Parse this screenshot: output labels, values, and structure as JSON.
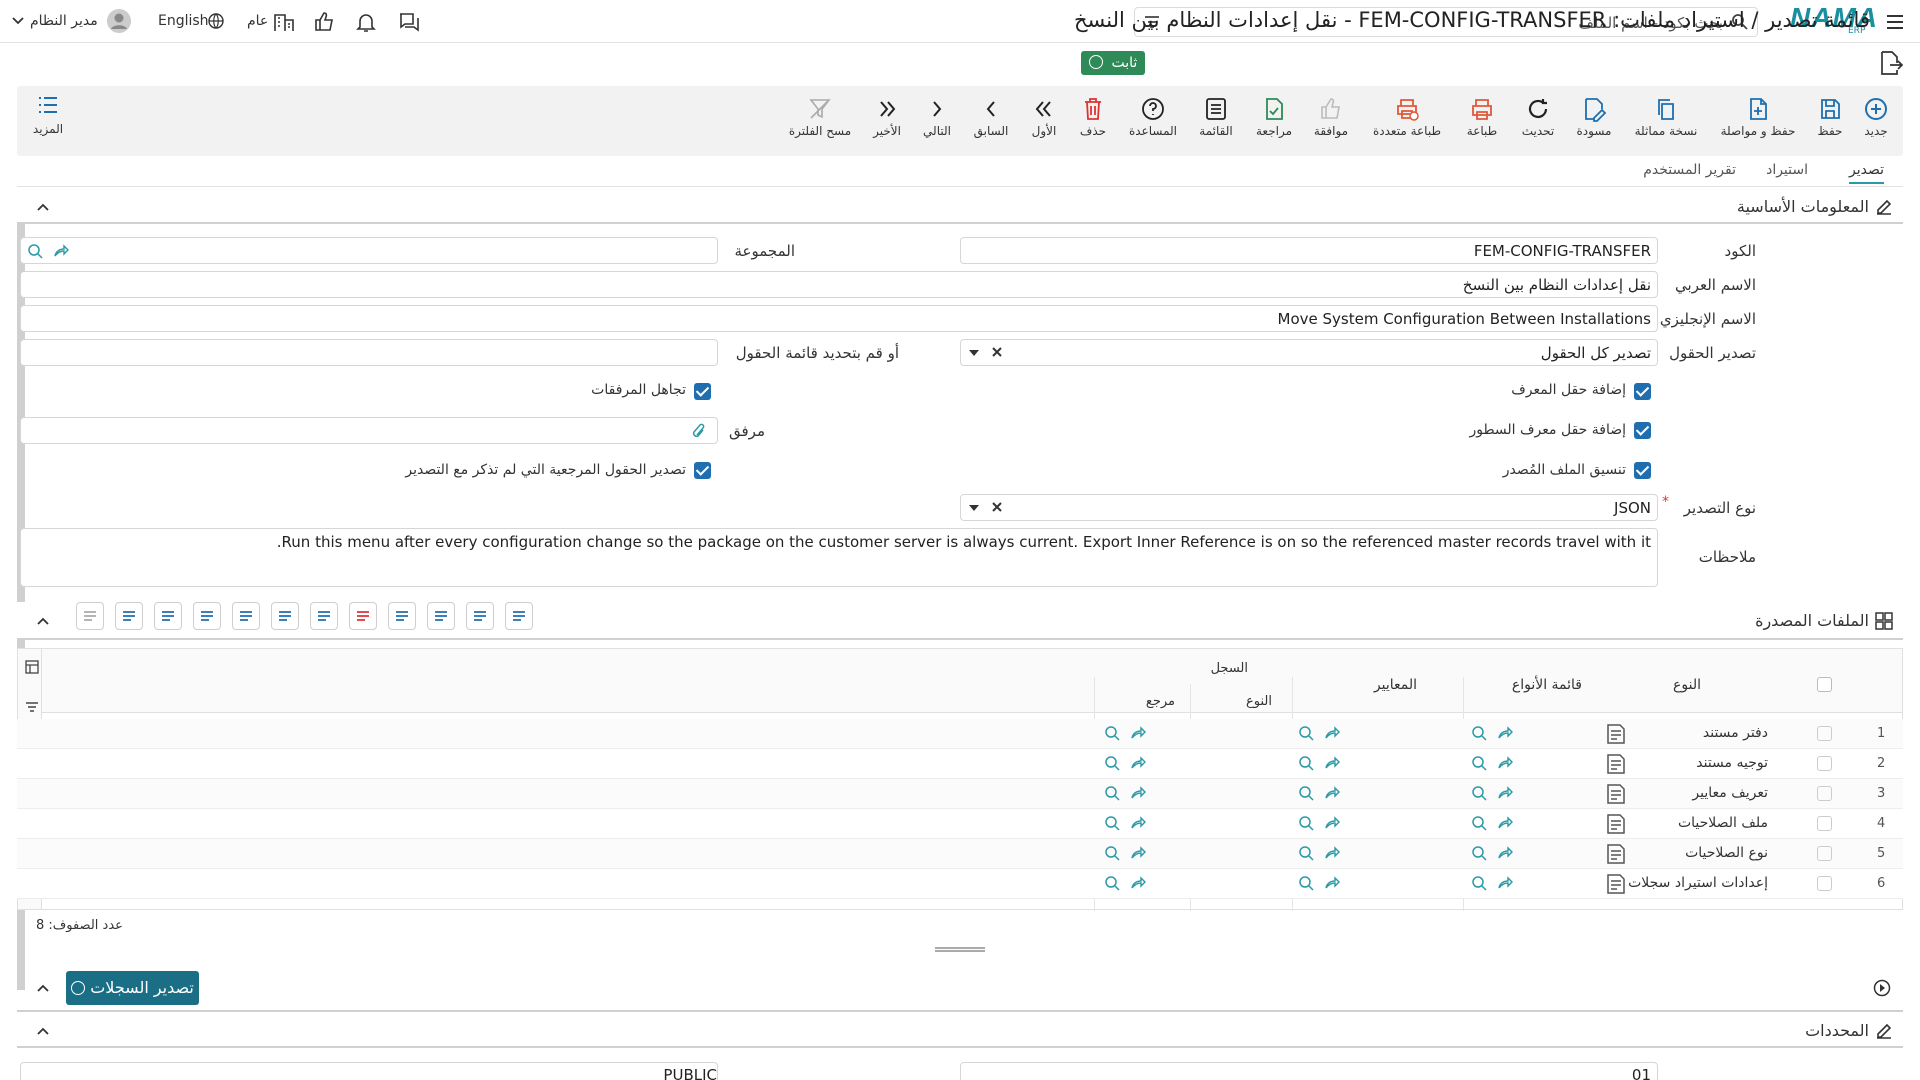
{
  "header": {
    "logo": "NAMA",
    "logo_sub": "ERP",
    "search_placeholder": "بحث بكود - اسم الملف",
    "user": "مدير النظام",
    "language": "English",
    "scope": "عام"
  },
  "page": {
    "title": "قائمة تصدير / استيراد ملفات: FEM-CONFIG-TRANSFER - نقل إعدادات النظام بين النسخ",
    "status_badge": "ثابت"
  },
  "toolbar": {
    "items": [
      {
        "label": "جديد",
        "icon": "plus-circle-icon"
      },
      {
        "label": "حفظ",
        "icon": "save-icon"
      },
      {
        "label": "حفظ و مواصلة",
        "icon": "save-continue-icon"
      },
      {
        "label": "نسخة مماثلة",
        "icon": "copy-icon"
      },
      {
        "label": "مسودة",
        "icon": "draft-icon"
      },
      {
        "label": "تحديث",
        "icon": "refresh-icon"
      },
      {
        "label": "طباعة",
        "icon": "print-icon"
      },
      {
        "label": "طباعة متعددة",
        "icon": "multi-print-icon"
      },
      {
        "label": "موافقة",
        "icon": "thumbs-up-icon"
      },
      {
        "label": "مراجعة",
        "icon": "review-icon"
      },
      {
        "label": "القائمة",
        "icon": "list-icon"
      },
      {
        "label": "المساعدة",
        "icon": "help-icon"
      },
      {
        "label": "حذف",
        "icon": "trash-icon"
      },
      {
        "label": "الأول",
        "icon": "first-icon"
      },
      {
        "label": "السابق",
        "icon": "prev-icon"
      },
      {
        "label": "التالي",
        "icon": "next-icon"
      },
      {
        "label": "الأخير",
        "icon": "last-icon"
      },
      {
        "label": "مسح الفلترة",
        "icon": "clear-filter-icon"
      }
    ],
    "more": "المزيد"
  },
  "tabs": [
    "تصدير",
    "استيراد",
    "تقرير المستخدم"
  ],
  "basic": {
    "section": "المعلومات الأساسية",
    "code_label": "الكود",
    "code": "FEM-CONFIG-TRANSFER",
    "group_label": "المجموعة",
    "ar_name_label": "الاسم العربي",
    "ar_name": "نقل إعدادات النظام بين النسخ",
    "en_name_label": "الاسم الإنجليزي",
    "en_name": "Move System Configuration Between Installations",
    "fields_label": "تصدير الحقول",
    "fields_value": "تصدير كل الحقول",
    "fields_list_label": "أو قم بتحديد قائمة الحقول",
    "add_id": "إضافة حقل المعرف",
    "ignore_att": "تجاهل المرفقات",
    "add_line_id": "إضافة حقل معرف السطور",
    "attachment_label": "مرفق",
    "format_src": "تنسيق الملف المُصدر",
    "export_ref": "تصدير الحقول المرجعية التي لم تذكر مع التصدير",
    "type_label": "نوع التصدير",
    "type_value": "JSON",
    "notes_label": "ملاحظات",
    "notes": "Run this menu after every configuration change so the package on the customer server is always current. Export Inner Reference is on so the referenced master records travel with it."
  },
  "files": {
    "section": "الملفات المصدرة",
    "col_type": "النوع",
    "col_types_list": "قائمة الأنواع",
    "col_criteria": "المعايير",
    "col_record": "السجل",
    "col_rec_type": "النوع",
    "col_ref": "مرجع",
    "rows": [
      {
        "n": "1",
        "name": "دفتر مستند"
      },
      {
        "n": "2",
        "name": "توجيه مستند"
      },
      {
        "n": "3",
        "name": "تعريف معايير"
      },
      {
        "n": "4",
        "name": "ملف الصلاحيات"
      },
      {
        "n": "5",
        "name": "نوع الصلاحيات"
      },
      {
        "n": "6",
        "name": "إعدادات استيراد سجلات"
      }
    ],
    "row_count": "عدد الصفوف: 8"
  },
  "export_button": "تصدير السجلات",
  "limits": {
    "section": "المحددات",
    "peek1": "01",
    "peek2": "PUBLIC"
  }
}
